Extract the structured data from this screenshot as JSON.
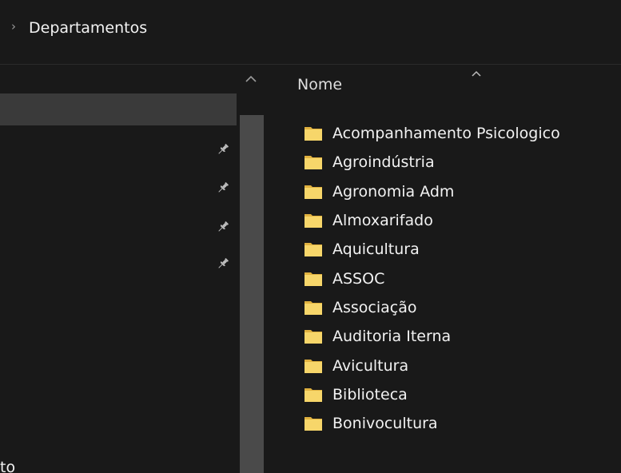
{
  "breadcrumb": {
    "separator": "›",
    "current": "Departamentos"
  },
  "nav_pane": {
    "partial_item_label": "nto"
  },
  "content": {
    "column_header": "Nome",
    "items": [
      {
        "name": "Acompanhamento Psicologico",
        "icon": "folder-icon"
      },
      {
        "name": "Agroindústria",
        "icon": "folder-icon"
      },
      {
        "name": "Agronomia Adm",
        "icon": "folder-icon"
      },
      {
        "name": "Almoxarifado",
        "icon": "folder-icon"
      },
      {
        "name": "Aquicultura",
        "icon": "folder-icon"
      },
      {
        "name": "ASSOC",
        "icon": "folder-icon"
      },
      {
        "name": "Associação",
        "icon": "folder-icon"
      },
      {
        "name": "Auditoria Iterna",
        "icon": "folder-icon"
      },
      {
        "name": "Avicultura",
        "icon": "folder-icon"
      },
      {
        "name": "Biblioteca",
        "icon": "folder-icon"
      },
      {
        "name": "Bonivocultura",
        "icon": "folder-icon"
      }
    ]
  },
  "colors": {
    "background": "#191919",
    "selected_nav": "#3a3a3a",
    "folder": "#f7d66a",
    "text": "#f2f2f2"
  }
}
